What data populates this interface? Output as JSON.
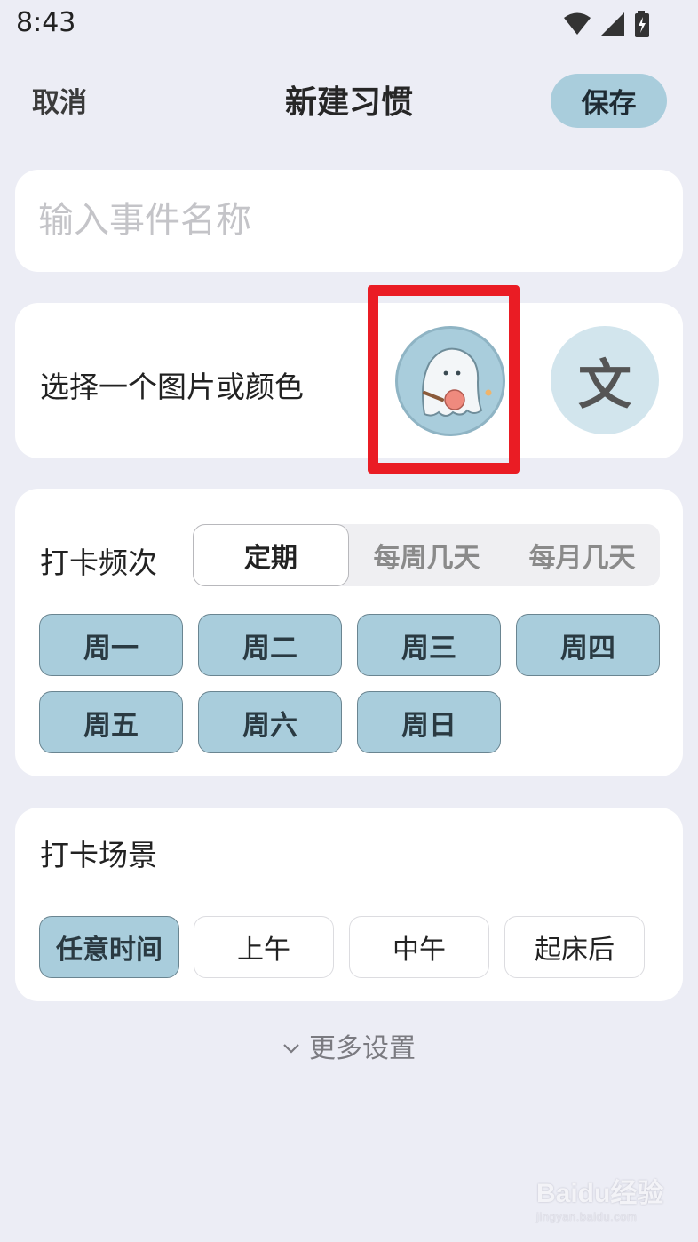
{
  "status_bar": {
    "time": "8:43",
    "icons": [
      "wifi-icon",
      "signal-icon",
      "battery-charging-icon"
    ]
  },
  "header": {
    "cancel_label": "取消",
    "title": "新建习惯",
    "save_label": "保存"
  },
  "name_field": {
    "placeholder": "输入事件名称",
    "value": ""
  },
  "picture_section": {
    "label": "选择一个图片或颜色",
    "text_option_glyph": "文"
  },
  "frequency": {
    "label": "打卡频次",
    "tabs": [
      {
        "label": "定期",
        "active": true
      },
      {
        "label": "每周几天",
        "active": false
      },
      {
        "label": "每月几天",
        "active": false
      }
    ],
    "days": [
      "周一",
      "周二",
      "周三",
      "周四",
      "周五",
      "周六",
      "周日"
    ]
  },
  "scene": {
    "label": "打卡场景",
    "options": [
      {
        "label": "任意时间",
        "active": true
      },
      {
        "label": "上午",
        "active": false
      },
      {
        "label": "中午",
        "active": false
      },
      {
        "label": "起床后",
        "active": false
      }
    ]
  },
  "more_settings_label": "更多设置",
  "watermark": {
    "brand": "Baidu经验",
    "sub": "jingyan.baidu.com"
  },
  "colors": {
    "background": "#ecedf5",
    "accent": "#a9cddc",
    "highlight": "#ea1c24"
  }
}
